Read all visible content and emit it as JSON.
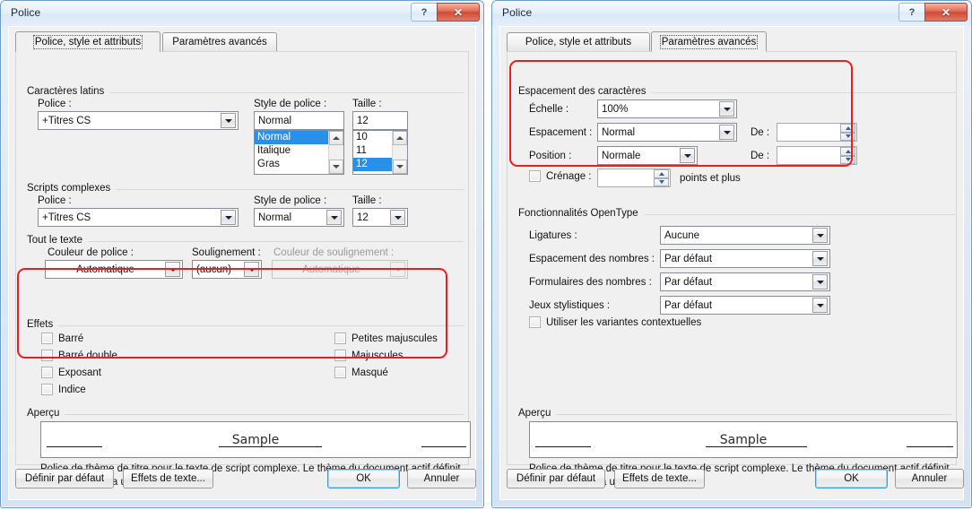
{
  "left_dialog": {
    "title": "Police",
    "window_buttons": {
      "help": "?",
      "close": "✕"
    },
    "tabs": [
      {
        "label": "Police, style et attributs",
        "selected": true
      },
      {
        "label": "Paramètres avancés",
        "selected": false
      }
    ],
    "latin_group": {
      "title": "Caractères latins",
      "font_label": "Police :",
      "font_value": "+Titres CS",
      "style_label": "Style de police :",
      "style_value": "Normal",
      "style_options": [
        "Normal",
        "Italique",
        "Gras"
      ],
      "style_selected_index": 0,
      "size_label": "Taille :",
      "size_value": "12",
      "size_options": [
        "10",
        "11",
        "12"
      ],
      "size_selected_index": 2
    },
    "complex_group": {
      "title": "Scripts complexes",
      "font_label": "Police :",
      "font_value": "+Titres CS",
      "style_label": "Style de police :",
      "style_value": "Normal",
      "size_label": "Taille :",
      "size_value": "12"
    },
    "alltext_group": {
      "title": "Tout le texte",
      "fontcolor_label": "Couleur de police :",
      "fontcolor_value": "Automatique",
      "underline_label": "Soulignement :",
      "underline_value": "(aucun)",
      "underlinecolor_label": "Couleur de soulignement :",
      "underlinecolor_value": "Automatique"
    },
    "effects_group": {
      "title": "Effets",
      "left_items": [
        "Barré",
        "Barré double",
        "Exposant",
        "Indice"
      ],
      "right_items": [
        "Petites majuscules",
        "Majuscules",
        "Masqué"
      ]
    },
    "preview_group": {
      "title": "Aperçu",
      "sample": "Sample",
      "description": "Police de thème de titre pour le texte de script complexe. Le thème du document actif définit la police qui sera utilisée."
    },
    "buttons": {
      "default": "Définir par défaut",
      "text_effects": "Effets de texte...",
      "ok": "OK",
      "cancel": "Annuler"
    }
  },
  "right_dialog": {
    "title": "Police",
    "window_buttons": {
      "help": "?",
      "close": "✕"
    },
    "tabs": [
      {
        "label": "Police, style et attributs",
        "selected": false
      },
      {
        "label": "Paramètres avancés",
        "selected": true
      }
    ],
    "spacing_group": {
      "title": "Espacement des caractères",
      "scale_label": "Échelle :",
      "scale_value": "100%",
      "spacing_label": "Espacement :",
      "spacing_value": "Normal",
      "spacing_by_label": "De :",
      "spacing_by_value": "",
      "position_label": "Position :",
      "position_value": "Normale",
      "position_by_label": "De :",
      "position_by_value": "",
      "kerning_label": "Crénage :",
      "kerning_value": "",
      "kerning_suffix": "points et plus"
    },
    "opentype_group": {
      "title": "Fonctionnalités OpenType",
      "ligatures_label": "Ligatures :",
      "ligatures_value": "Aucune",
      "numberspacing_label": "Espacement des nombres :",
      "numberspacing_value": "Par défaut",
      "numberforms_label": "Formulaires des nombres :",
      "numberforms_value": "Par défaut",
      "stylisticsets_label": "Jeux stylistiques :",
      "stylisticsets_value": "Par défaut",
      "contextual_label": "Utiliser les variantes contextuelles"
    },
    "preview_group": {
      "title": "Aperçu",
      "sample": "Sample",
      "description": "Police de thème de titre pour le texte de script complexe. Le thème du document actif définit la police qui sera utilisée."
    },
    "buttons": {
      "default": "Définir par défaut",
      "text_effects": "Effets de texte...",
      "ok": "OK",
      "cancel": "Annuler"
    }
  },
  "annotations": {
    "accent_color": "#ee1c1c",
    "highlight_left": "Effets",
    "highlight_right": "Espacement des caractères"
  }
}
